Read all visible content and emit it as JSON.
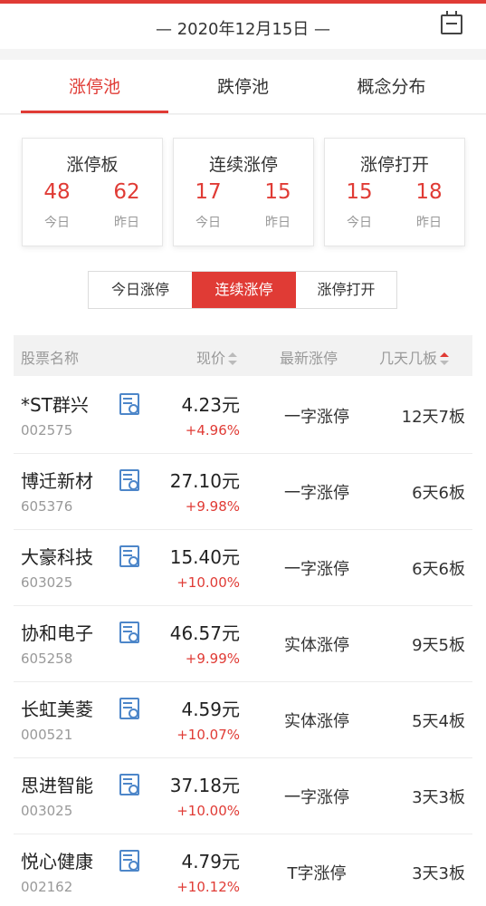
{
  "header": {
    "date": "— 2020年12月15日 —",
    "calendar_icon": "calendar-icon"
  },
  "tabs": [
    {
      "label": "涨停池",
      "active": true
    },
    {
      "label": "跌停池",
      "active": false
    },
    {
      "label": "概念分布",
      "active": false
    }
  ],
  "accent_color": "#e03b35",
  "cards": [
    {
      "title": "涨停板",
      "today": "48",
      "yesterday": "62",
      "today_label": "今日",
      "yesterday_label": "昨日"
    },
    {
      "title": "连续涨停",
      "today": "17",
      "yesterday": "15",
      "today_label": "今日",
      "yesterday_label": "昨日"
    },
    {
      "title": "涨停打开",
      "today": "15",
      "yesterday": "18",
      "today_label": "今日",
      "yesterday_label": "昨日"
    }
  ],
  "segments": [
    {
      "label": "今日涨停",
      "active": false
    },
    {
      "label": "连续涨停",
      "active": true
    },
    {
      "label": "涨停打开",
      "active": false
    }
  ],
  "table": {
    "headers": {
      "name": "股票名称",
      "price": "现价",
      "latest": "最新涨停",
      "days": "几天几板"
    },
    "rows": [
      {
        "name": "*ST群兴",
        "code": "002575",
        "price": "4.23元",
        "change": "+4.96%",
        "status": "一字涨停",
        "days": "12天7板"
      },
      {
        "name": "博迁新材",
        "code": "605376",
        "price": "27.10元",
        "change": "+9.98%",
        "status": "一字涨停",
        "days": "6天6板"
      },
      {
        "name": "大豪科技",
        "code": "603025",
        "price": "15.40元",
        "change": "+10.00%",
        "status": "一字涨停",
        "days": "6天6板"
      },
      {
        "name": "协和电子",
        "code": "605258",
        "price": "46.57元",
        "change": "+9.99%",
        "status": "实体涨停",
        "days": "9天5板"
      },
      {
        "name": "长虹美菱",
        "code": "000521",
        "price": "4.59元",
        "change": "+10.07%",
        "status": "实体涨停",
        "days": "5天4板"
      },
      {
        "name": "思进智能",
        "code": "003025",
        "price": "37.18元",
        "change": "+10.00%",
        "status": "一字涨停",
        "days": "3天3板"
      },
      {
        "name": "悦心健康",
        "code": "002162",
        "price": "4.79元",
        "change": "+10.12%",
        "status": "T字涨停",
        "days": "3天3板"
      }
    ]
  }
}
